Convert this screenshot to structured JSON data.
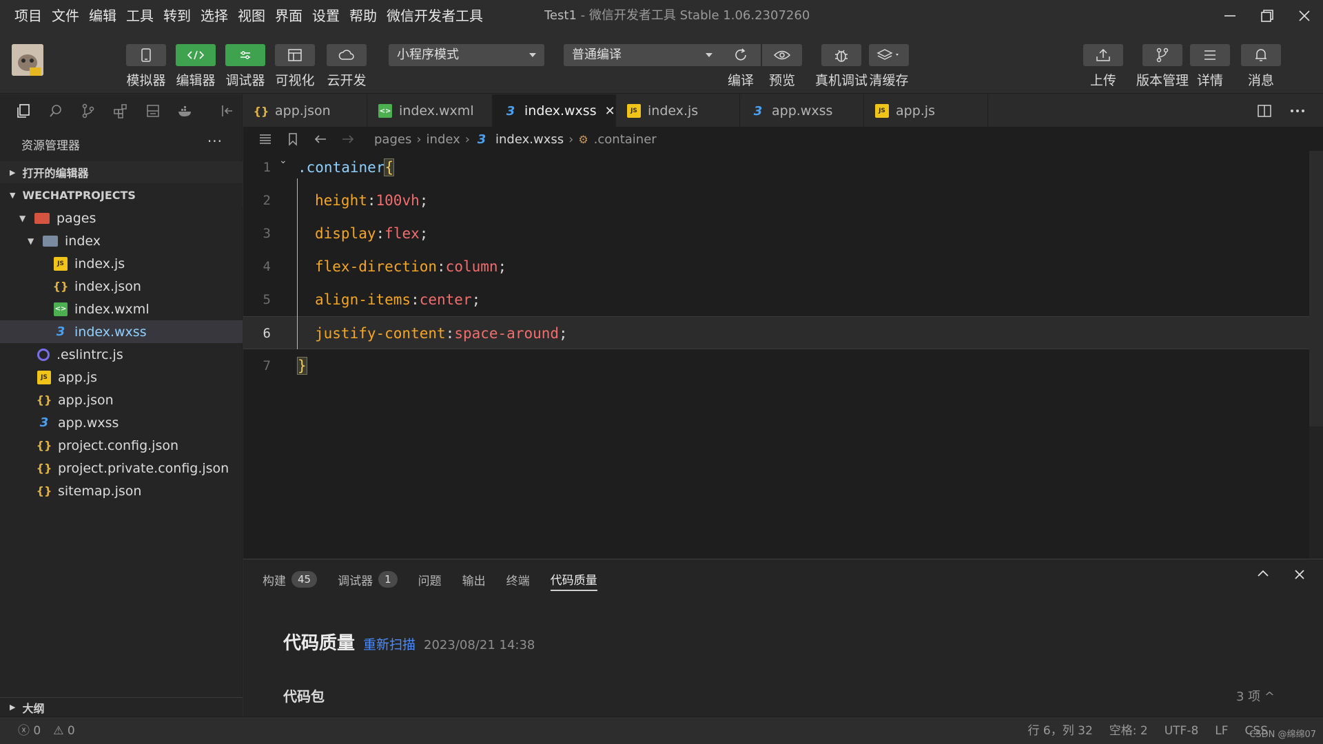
{
  "menu": [
    "项目",
    "文件",
    "编辑",
    "工具",
    "转到",
    "选择",
    "视图",
    "界面",
    "设置",
    "帮助",
    "微信开发者工具"
  ],
  "window_title": {
    "project": "Test1",
    "rest": " - 微信开发者工具 Stable 1.06.2307260"
  },
  "toolbar": {
    "simulator": "模拟器",
    "editor": "编辑器",
    "debugger": "调试器",
    "visual": "可视化",
    "cloud": "云开发",
    "mode_select": "小程序模式",
    "compile_select": "普通编译",
    "compile": "编译",
    "preview": "预览",
    "device_debug": "真机调试",
    "clear_cache": "清缓存",
    "upload": "上传",
    "version": "版本管理",
    "details": "详情",
    "messages": "消息"
  },
  "explorer": {
    "title": "资源管理器",
    "more": "···",
    "open_editors": "打开的编辑器",
    "project_root": "WECHATPROJECTS",
    "tree": [
      {
        "label": "pages",
        "indent": 1
      },
      {
        "label": "index",
        "indent": 2
      },
      {
        "label": "index.js",
        "indent": 3
      },
      {
        "label": "index.json",
        "indent": 3
      },
      {
        "label": "index.wxml",
        "indent": 3
      },
      {
        "label": "index.wxss",
        "indent": 3
      },
      {
        "label": ".eslintrc.js",
        "indent": 1
      },
      {
        "label": "app.js",
        "indent": 1
      },
      {
        "label": "app.json",
        "indent": 1
      },
      {
        "label": "app.wxss",
        "indent": 1
      },
      {
        "label": "project.config.json",
        "indent": 1
      },
      {
        "label": "project.private.config.json",
        "indent": 1
      },
      {
        "label": "sitemap.json",
        "indent": 1
      }
    ],
    "outline": "大纲"
  },
  "tabs": [
    "app.json",
    "index.wxml",
    "index.wxss",
    "index.js",
    "app.wxss",
    "app.js"
  ],
  "breadcrumb": {
    "p1": "pages",
    "p2": "index",
    "file": "index.wxss",
    "symbol": ".container"
  },
  "code": {
    "l1_sel": ".container",
    "l1_brace": "{",
    "props": [
      {
        "name": "height",
        "value": "100vh"
      },
      {
        "name": "display",
        "value": "flex"
      },
      {
        "name": "flex-direction",
        "value": "column"
      },
      {
        "name": "align-items",
        "value": "center"
      },
      {
        "name": "justify-content",
        "value": "space-around"
      }
    ],
    "close_brace": "}",
    "line_numbers": [
      "1",
      "2",
      "3",
      "4",
      "5",
      "6",
      "7"
    ]
  },
  "panel": {
    "tab_build": "构建",
    "build_count": "45",
    "tab_debugger": "调试器",
    "debugger_count": "1",
    "tab_problems": "问题",
    "tab_output": "输出",
    "tab_terminal": "终端",
    "tab_quality": "代码质量",
    "quality_title": "代码质量",
    "rescan": "重新扫描",
    "scan_time": "2023/08/21 14:38",
    "package": "代码包",
    "count": "3 项"
  },
  "status": {
    "errors": "0",
    "warnings": "0",
    "position": "行 6，列 32",
    "spaces": "空格: 2",
    "encoding": "UTF-8",
    "eol": "LF",
    "lang": "CSS",
    "watermark": "CSDN @绵绵07"
  }
}
